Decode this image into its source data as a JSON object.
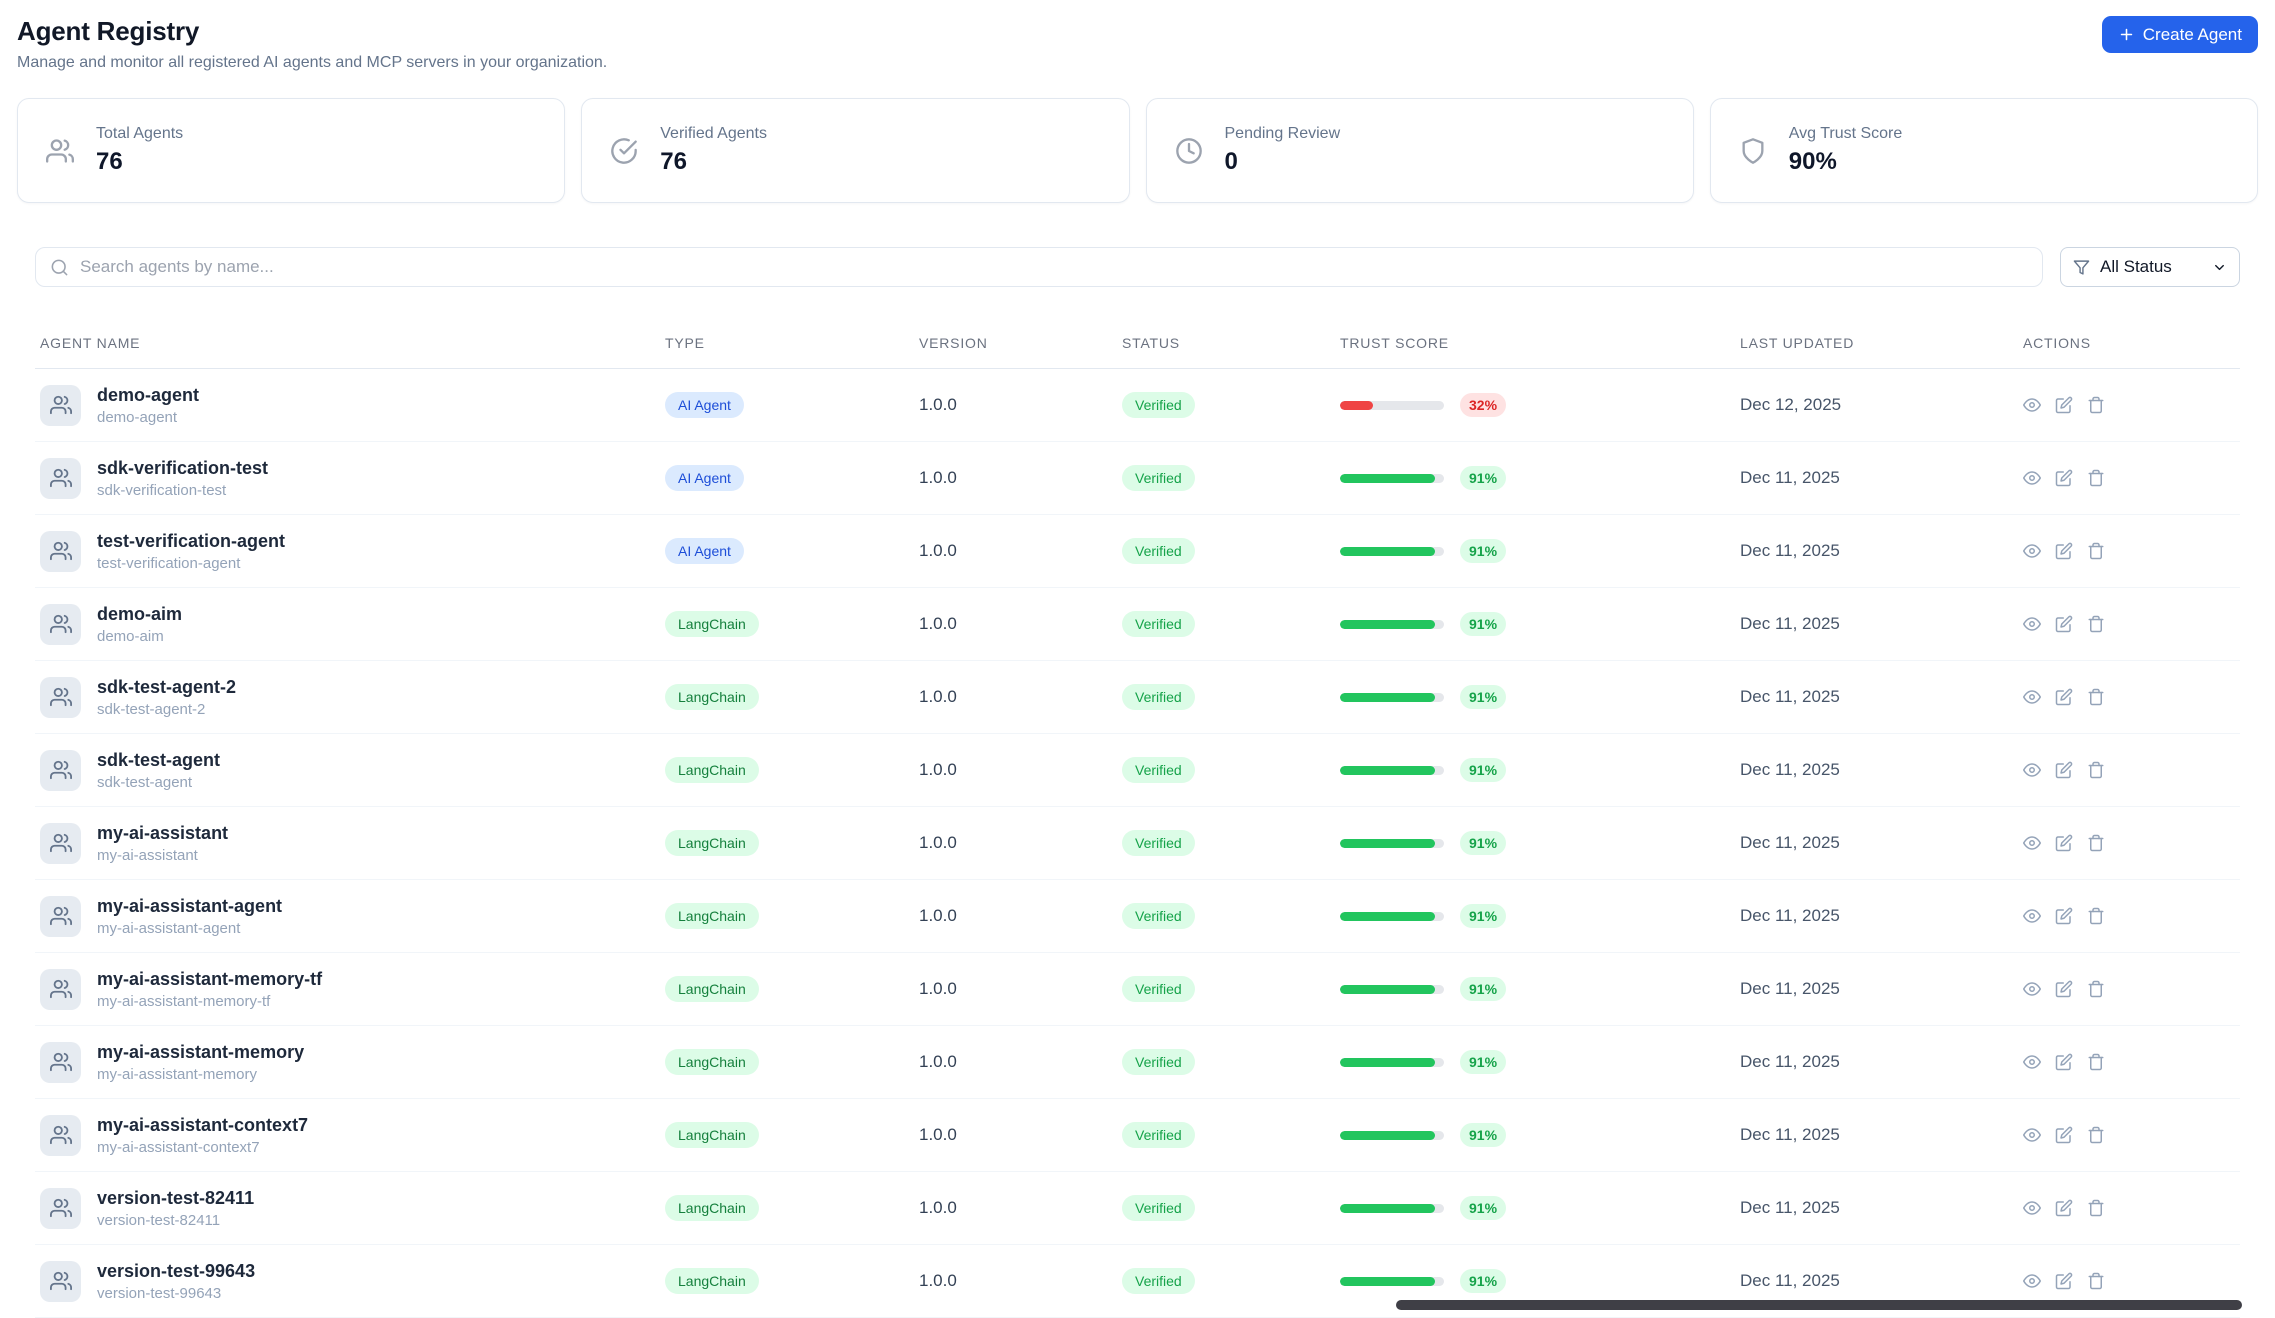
{
  "header": {
    "title": "Agent Registry",
    "subtitle": "Manage and monitor all registered AI agents and MCP servers in your organization.",
    "create_button_label": "Create Agent",
    "create_button_icon": "plus-icon"
  },
  "stats": [
    {
      "icon": "users-icon",
      "label": "Total Agents",
      "value": "76"
    },
    {
      "icon": "check-circle-icon",
      "label": "Verified Agents",
      "value": "76"
    },
    {
      "icon": "clock-icon",
      "label": "Pending Review",
      "value": "0"
    },
    {
      "icon": "shield-icon",
      "label": "Avg Trust Score",
      "value": "90%"
    }
  ],
  "filters": {
    "search_placeholder": "Search agents by name...",
    "search_icon": "search-icon",
    "status_filter_value": "All Status",
    "status_filter_icon": "filter-icon"
  },
  "table": {
    "columns": [
      "AGENT NAME",
      "TYPE",
      "VERSION",
      "STATUS",
      "TRUST SCORE",
      "LAST UPDATED",
      "ACTIONS"
    ],
    "row_action_icons": [
      "eye-icon",
      "edit-icon",
      "trash-icon"
    ],
    "rows": [
      {
        "name": "demo-agent",
        "slug": "demo-agent",
        "type": "AI Agent",
        "type_color": "blue",
        "version": "1.0.0",
        "status": "Verified",
        "trust_percent": 32,
        "trust_label": "32%",
        "trust_color": "red",
        "last_updated": "Dec 12, 2025"
      },
      {
        "name": "sdk-verification-test",
        "slug": "sdk-verification-test",
        "type": "AI Agent",
        "type_color": "blue",
        "version": "1.0.0",
        "status": "Verified",
        "trust_percent": 91,
        "trust_label": "91%",
        "trust_color": "green",
        "last_updated": "Dec 11, 2025"
      },
      {
        "name": "test-verification-agent",
        "slug": "test-verification-agent",
        "type": "AI Agent",
        "type_color": "blue",
        "version": "1.0.0",
        "status": "Verified",
        "trust_percent": 91,
        "trust_label": "91%",
        "trust_color": "green",
        "last_updated": "Dec 11, 2025"
      },
      {
        "name": "demo-aim",
        "slug": "demo-aim",
        "type": "LangChain",
        "type_color": "green",
        "version": "1.0.0",
        "status": "Verified",
        "trust_percent": 91,
        "trust_label": "91%",
        "trust_color": "green",
        "last_updated": "Dec 11, 2025"
      },
      {
        "name": "sdk-test-agent-2",
        "slug": "sdk-test-agent-2",
        "type": "LangChain",
        "type_color": "green",
        "version": "1.0.0",
        "status": "Verified",
        "trust_percent": 91,
        "trust_label": "91%",
        "trust_color": "green",
        "last_updated": "Dec 11, 2025"
      },
      {
        "name": "sdk-test-agent",
        "slug": "sdk-test-agent",
        "type": "LangChain",
        "type_color": "green",
        "version": "1.0.0",
        "status": "Verified",
        "trust_percent": 91,
        "trust_label": "91%",
        "trust_color": "green",
        "last_updated": "Dec 11, 2025"
      },
      {
        "name": "my-ai-assistant",
        "slug": "my-ai-assistant",
        "type": "LangChain",
        "type_color": "green",
        "version": "1.0.0",
        "status": "Verified",
        "trust_percent": 91,
        "trust_label": "91%",
        "trust_color": "green",
        "last_updated": "Dec 11, 2025"
      },
      {
        "name": "my-ai-assistant-agent",
        "slug": "my-ai-assistant-agent",
        "type": "LangChain",
        "type_color": "green",
        "version": "1.0.0",
        "status": "Verified",
        "trust_percent": 91,
        "trust_label": "91%",
        "trust_color": "green",
        "last_updated": "Dec 11, 2025"
      },
      {
        "name": "my-ai-assistant-memory-tf",
        "slug": "my-ai-assistant-memory-tf",
        "type": "LangChain",
        "type_color": "green",
        "version": "1.0.0",
        "status": "Verified",
        "trust_percent": 91,
        "trust_label": "91%",
        "trust_color": "green",
        "last_updated": "Dec 11, 2025"
      },
      {
        "name": "my-ai-assistant-memory",
        "slug": "my-ai-assistant-memory",
        "type": "LangChain",
        "type_color": "green",
        "version": "1.0.0",
        "status": "Verified",
        "trust_percent": 91,
        "trust_label": "91%",
        "trust_color": "green",
        "last_updated": "Dec 11, 2025"
      },
      {
        "name": "my-ai-assistant-context7",
        "slug": "my-ai-assistant-context7",
        "type": "LangChain",
        "type_color": "green",
        "version": "1.0.0",
        "status": "Verified",
        "trust_percent": 91,
        "trust_label": "91%",
        "trust_color": "green",
        "last_updated": "Dec 11, 2025"
      },
      {
        "name": "version-test-82411",
        "slug": "version-test-82411",
        "type": "LangChain",
        "type_color": "green",
        "version": "1.0.0",
        "status": "Verified",
        "trust_percent": 91,
        "trust_label": "91%",
        "trust_color": "green",
        "last_updated": "Dec 11, 2025"
      },
      {
        "name": "version-test-99643",
        "slug": "version-test-99643",
        "type": "LangChain",
        "type_color": "green",
        "version": "1.0.0",
        "status": "Verified",
        "trust_percent": 91,
        "trust_label": "91%",
        "trust_color": "green",
        "last_updated": "Dec 11, 2025"
      }
    ]
  },
  "colors": {
    "accent_blue": "#2563eb",
    "verified_green_text": "#16a34a",
    "verified_green_bg": "#dcfce7",
    "trust_low_red_text": "#dc2626",
    "trust_low_red_bg": "#fee2e2",
    "trust_bar_green": "#22c55e",
    "trust_bar_red": "#ef4444",
    "type_ai_agent_text": "#1d4ed8",
    "type_ai_agent_bg": "#dbeafe",
    "type_langchain_text": "#15803d",
    "type_langchain_bg": "#dcfce7"
  }
}
